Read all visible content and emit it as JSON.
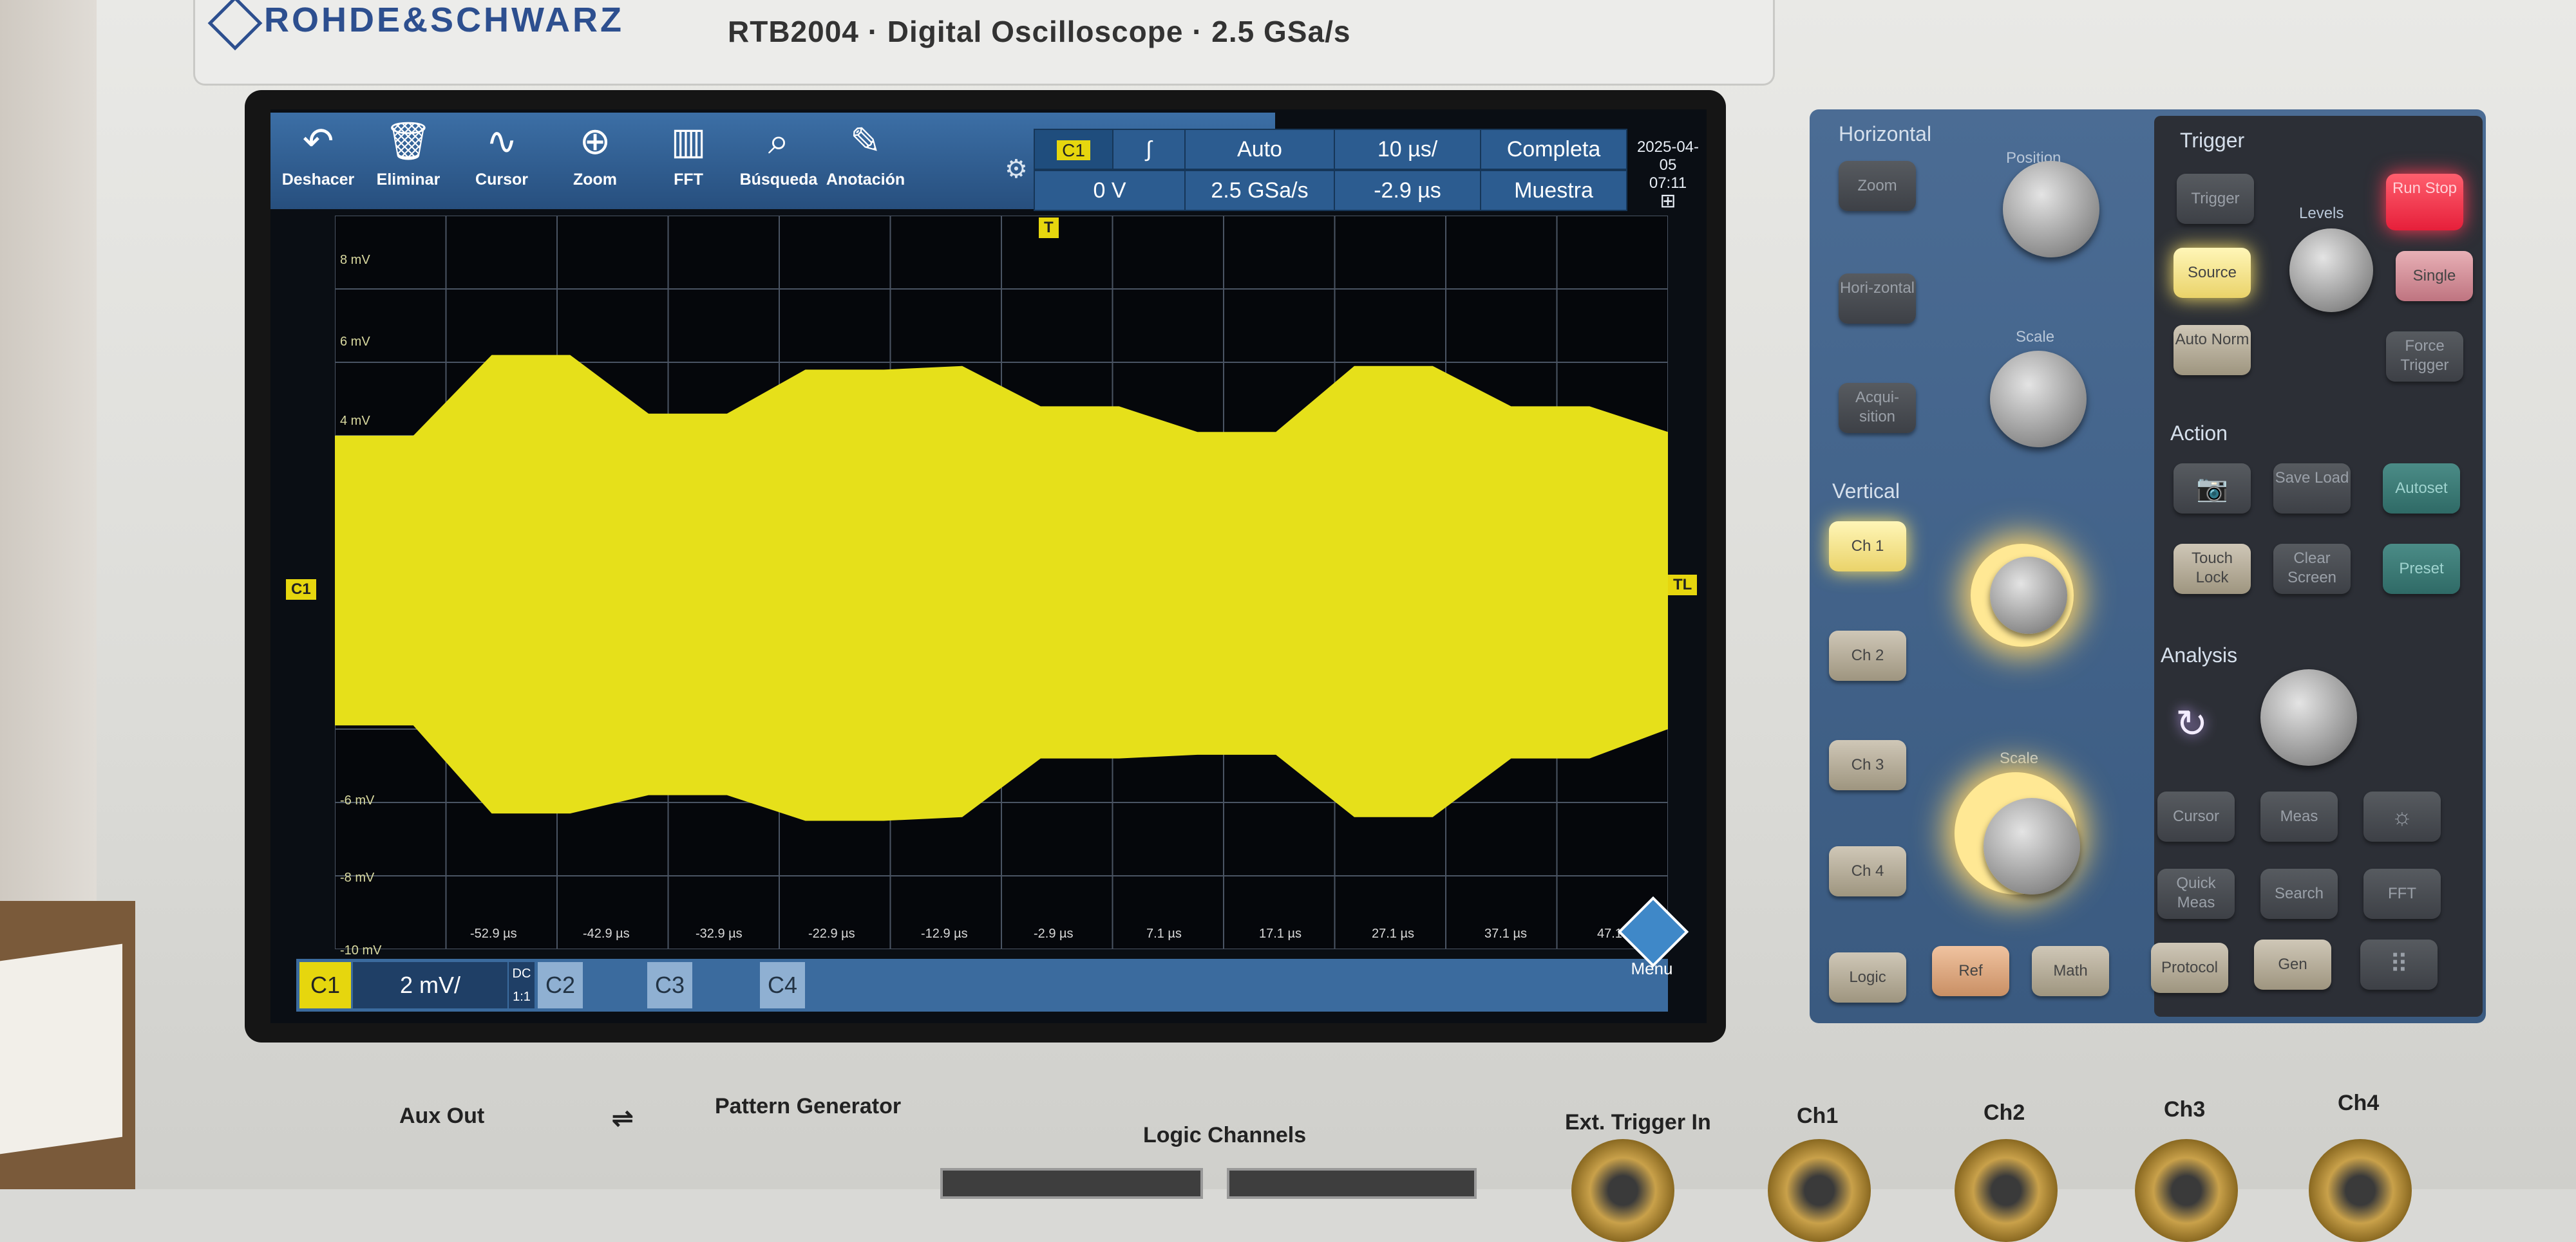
{
  "brand": "ROHDE&SCHWARZ",
  "model": "RTB2004 · Digital Oscilloscope · 2.5 GSa/s",
  "toolbar": [
    {
      "label": "Deshacer",
      "icon": "undo-icon",
      "glyph": "↶"
    },
    {
      "label": "Eliminar",
      "icon": "trash-icon",
      "glyph": "🗑"
    },
    {
      "label": "Cursor",
      "icon": "cursor-wave-icon",
      "glyph": "∿"
    },
    {
      "label": "Zoom",
      "icon": "zoom-icon",
      "glyph": "⊕"
    },
    {
      "label": "FFT",
      "icon": "fft-icon",
      "glyph": "▥"
    },
    {
      "label": "Búsqueda",
      "icon": "search-icon",
      "glyph": "⌕"
    },
    {
      "label": "Anotación",
      "icon": "pencil-icon",
      "glyph": "✎"
    }
  ],
  "status": {
    "channel": "C1",
    "slope_icon": "rising-edge-icon",
    "slope_glyph": "∫",
    "trigger_mode": "Auto",
    "time_scale": "10 µs/",
    "acquisition": "Completa",
    "trigger_level": "0 V",
    "sample_rate": "2.5 GSa/s",
    "time_offset": "-2.9 µs",
    "acq_mode": "Muestra",
    "date": "2025-04-05",
    "time": "07:11"
  },
  "plot": {
    "y_labels": [
      "8 mV",
      "6 mV",
      "4 mV",
      "-6 mV",
      "-8 mV",
      "-10 mV"
    ],
    "x_labels": [
      "-52.9 µs",
      "-42.9 µs",
      "-32.9 µs",
      "-22.9 µs",
      "-12.9 µs",
      "-2.9 µs",
      "7.1 µs",
      "17.1 µs",
      "27.1 µs",
      "37.1 µs",
      "47.1 µs"
    ],
    "trigger_marker": "T",
    "channel_marker": "C1",
    "level_marker": "TL",
    "trace_color": "#e6e01a",
    "envelope_upper_mV": [
      4.0,
      4.0,
      6.2,
      6.2,
      4.6,
      4.6,
      5.8,
      5.8,
      5.9,
      4.8,
      4.8,
      4.1,
      4.1,
      5.9,
      5.9,
      4.8,
      4.8,
      4.1
    ],
    "envelope_lower_mV": [
      -3.9,
      -3.9,
      -6.3,
      -6.3,
      -5.8,
      -5.8,
      -6.5,
      -6.5,
      -6.4,
      -4.8,
      -4.8,
      -4.7,
      -4.7,
      -6.4,
      -6.4,
      -4.8,
      -4.8,
      -4.0
    ]
  },
  "bottom": {
    "ch1_label": "C1",
    "ch1_scale": "2 mV/",
    "ch1_coupling": "DC",
    "ch1_probe": "1:1",
    "ch2_label": "C2",
    "ch3_label": "C3",
    "ch4_label": "C4",
    "menu_label": "Menu"
  },
  "panel": {
    "horizontal_title": "Horizontal",
    "position_label": "Position",
    "scale_label": "Scale",
    "zoom_btn": "Zoom",
    "horizontal_btn": "Hori-zontal",
    "acquisition_btn": "Acqui-sition",
    "vertical_title": "Vertical",
    "ch1_btn": "Ch 1",
    "ch2_btn": "Ch 2",
    "ch3_btn": "Ch 3",
    "ch4_btn": "Ch 4",
    "logic_btn": "Logic",
    "ref_btn": "Ref",
    "math_btn": "Math",
    "trigger_title": "Trigger",
    "trigger_btn": "Trigger",
    "source_btn": "Source",
    "auto_norm_btn": "Auto Norm",
    "levels_label": "Levels",
    "run_stop_btn": "Run Stop",
    "single_btn": "Single",
    "force_trigger_btn": "Force Trigger",
    "action_title": "Action",
    "screenshot_btn": "Screenshot",
    "save_load_btn": "Save Load",
    "autoset_btn": "Autoset",
    "touch_lock_btn": "Touch Lock",
    "clear_screen_btn": "Clear Screen",
    "preset_btn": "Preset",
    "analysis_title": "Analysis",
    "cursor_btn": "Cursor",
    "meas_btn": "Meas",
    "quick_meas_btn": "Quick Meas",
    "search_btn": "Search",
    "fft_btn": "FFT",
    "protocol_btn": "Protocol",
    "gen_btn": "Gen"
  },
  "front": {
    "aux_out": "Aux Out",
    "pattern_generator": "Pattern Generator",
    "logic_channels": "Logic Channels",
    "ext_trigger": "Ext. Trigger In",
    "ch1": "Ch1",
    "ch2": "Ch2",
    "ch3": "Ch3",
    "ch4": "Ch4"
  }
}
